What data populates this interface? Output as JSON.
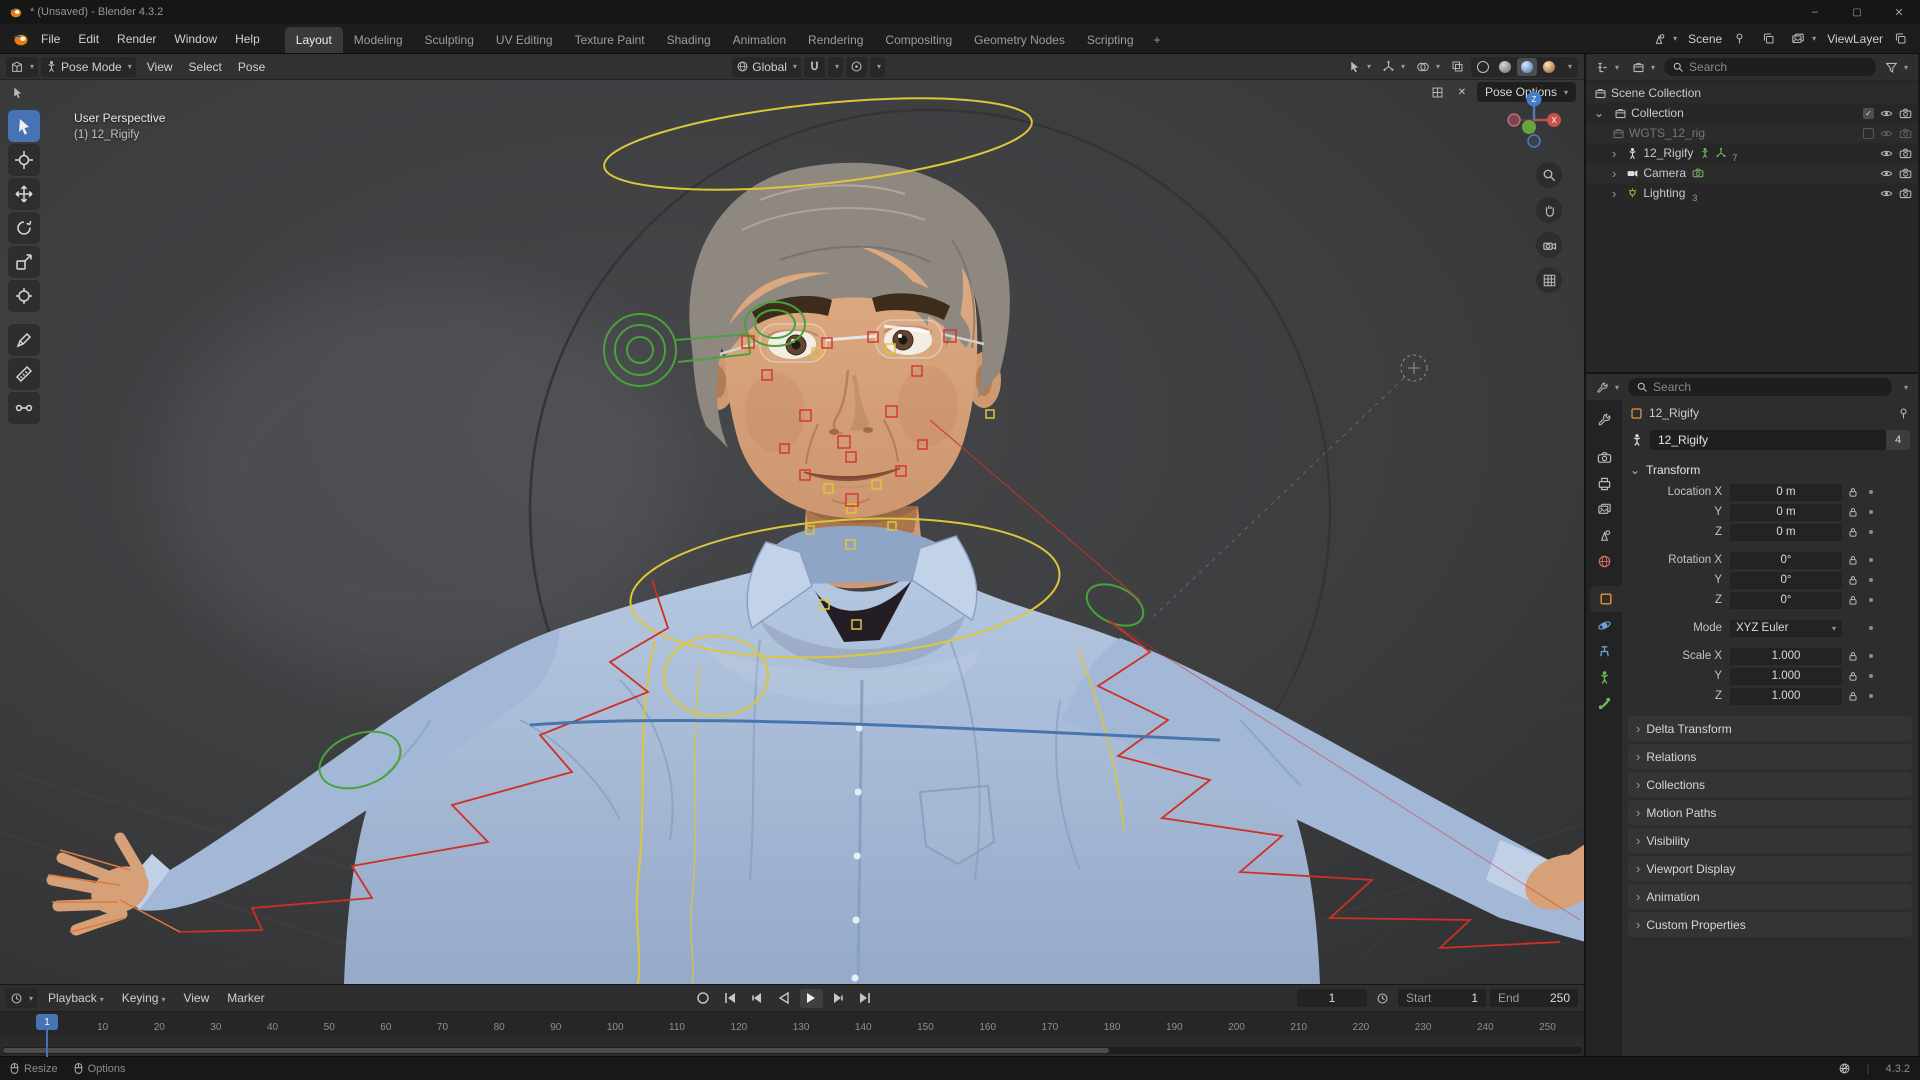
{
  "window": {
    "title": "* (Unsaved) - Blender 4.3.2"
  },
  "menubar": {
    "items": [
      "File",
      "Edit",
      "Render",
      "Window",
      "Help"
    ],
    "workspaces": [
      "Layout",
      "Modeling",
      "Sculpting",
      "UV Editing",
      "Texture Paint",
      "Shading",
      "Animation",
      "Rendering",
      "Compositing",
      "Geometry Nodes",
      "Scripting"
    ],
    "add_tab": "+",
    "scene_label": "Scene",
    "viewlayer_label": "ViewLayer"
  },
  "viewport": {
    "mode": "Pose Mode",
    "menus": [
      "View",
      "Select",
      "Pose"
    ],
    "orientation": "Global",
    "pose_options": "Pose Options",
    "overlay_line1": "User Perspective",
    "overlay_line2": "(1) 12_Rigify",
    "axis_z": "Z",
    "axis_x": "X"
  },
  "outliner": {
    "search_placeholder": "Search",
    "rows": [
      {
        "label": "Scene Collection"
      },
      {
        "label": "Collection"
      },
      {
        "label": "WGTS_12_rig"
      },
      {
        "label": "12_Rigify",
        "badge": "7"
      },
      {
        "label": "Camera"
      },
      {
        "label": "Lighting",
        "badge": "3"
      }
    ]
  },
  "properties": {
    "search_placeholder": "Search",
    "breadcrumb": "12_Rigify",
    "object_name": "12_Rigify",
    "users_count": "4",
    "transform_title": "Transform",
    "fields": {
      "loc_x": {
        "label": "Location X",
        "value": "0 m"
      },
      "loc_y": {
        "label": "Y",
        "value": "0 m"
      },
      "loc_z": {
        "label": "Z",
        "value": "0 m"
      },
      "rot_x": {
        "label": "Rotation X",
        "value": "0°"
      },
      "rot_y": {
        "label": "Y",
        "value": "0°"
      },
      "rot_z": {
        "label": "Z",
        "value": "0°"
      },
      "mode": {
        "label": "Mode",
        "value": "XYZ Euler"
      },
      "scale_x": {
        "label": "Scale X",
        "value": "1.000"
      },
      "scale_y": {
        "label": "Y",
        "value": "1.000"
      },
      "scale_z": {
        "label": "Z",
        "value": "1.000"
      }
    },
    "collapsed_panels": [
      "Delta Transform",
      "Relations",
      "Collections",
      "Motion Paths",
      "Visibility",
      "Viewport Display",
      "Animation",
      "Custom Properties"
    ]
  },
  "timeline": {
    "menus": [
      "Playback",
      "Keying",
      "View",
      "Marker"
    ],
    "frame_field": "1",
    "playhead": "1",
    "start_label": "Start",
    "start_value": "1",
    "end_label": "End",
    "end_value": "250",
    "ticks": [
      "1",
      "10",
      "20",
      "30",
      "40",
      "50",
      "60",
      "70",
      "80",
      "90",
      "100",
      "110",
      "120",
      "130",
      "140",
      "150",
      "160",
      "170",
      "180",
      "190",
      "200",
      "210",
      "220",
      "230",
      "240",
      "250"
    ]
  },
  "statusbar": {
    "resize": "Resize",
    "options": "Options",
    "version": "4.3.2"
  }
}
